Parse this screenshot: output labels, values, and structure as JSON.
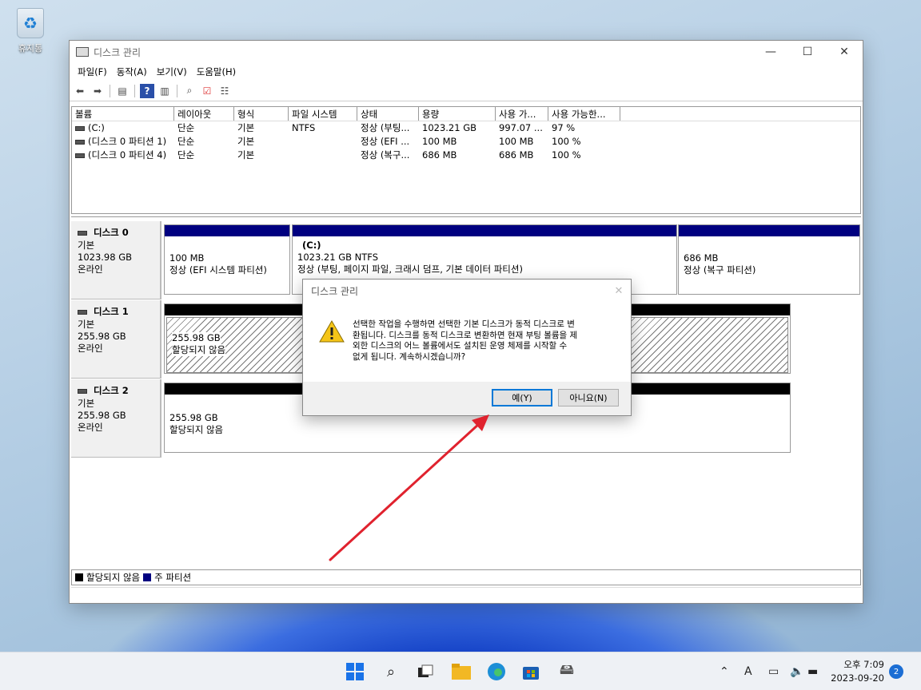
{
  "desktop": {
    "recycle_bin_label": "휴지통"
  },
  "window": {
    "title": "디스크 관리",
    "controls": {
      "minimize": "—",
      "maximize": "☐",
      "close": "✕"
    },
    "menu": [
      "파일(F)",
      "동작(A)",
      "보기(V)",
      "도움말(H)"
    ]
  },
  "volume_list": {
    "columns": [
      "볼륨",
      "레이아웃",
      "형식",
      "파일 시스템",
      "상태",
      "용량",
      "사용 가...",
      "사용 가능한..."
    ],
    "rows": [
      [
        "(C:)",
        "단순",
        "기본",
        "NTFS",
        "정상 (부팅...",
        "1023.21 GB",
        "997.07 ...",
        "97 %"
      ],
      [
        "(디스크 0 파티션 1)",
        "단순",
        "기본",
        "",
        "정상 (EFI ...",
        "100 MB",
        "100 MB",
        "100 %"
      ],
      [
        "(디스크 0 파티션 4)",
        "단순",
        "기본",
        "",
        "정상 (복구...",
        "686 MB",
        "686 MB",
        "100 %"
      ]
    ]
  },
  "disks": [
    {
      "name": "디스크 0",
      "type": "기본",
      "size": "1023.98 GB",
      "status": "온라인",
      "partitions": [
        {
          "label": "",
          "size": "100 MB",
          "status": "정상 (EFI 시스템 파티션)"
        },
        {
          "label": "(C:)",
          "size": "1023.21 GB NTFS",
          "status": "정상 (부팅, 페이지 파일, 크래시 덤프, 기본 데이터 파티션)"
        },
        {
          "label": "",
          "size": "686 MB",
          "status": "정상 (복구 파티션)"
        }
      ]
    },
    {
      "name": "디스크 1",
      "type": "기본",
      "size": "255.98 GB",
      "status": "온라인",
      "partitions": [
        {
          "size": "255.98 GB",
          "status": "할당되지 않음"
        }
      ]
    },
    {
      "name": "디스크 2",
      "type": "기본",
      "size": "255.98 GB",
      "status": "온라인",
      "partitions": [
        {
          "size": "255.98 GB",
          "status": "할당되지 않음"
        }
      ]
    }
  ],
  "legend": {
    "unallocated": "할당되지 않음",
    "primary": "주 파티션"
  },
  "dialog": {
    "title": "디스크 관리",
    "message_lines": [
      "선택한 작업을 수행하면 선택한 기본 디스크가 동적 디스크로 변",
      "환됩니다. 디스크를 동적 디스크로 변환하면 현재 부팅 볼륨을 제",
      "외한 디스크의 어느 볼륨에서도 설치된 운영 체제를 시작할 수",
      "없게 됩니다. 계속하시겠습니까?"
    ],
    "yes_label": "예(Y)",
    "no_label": "아니요(N)"
  },
  "colors": {
    "primary_partition": "#000080",
    "unallocated": "#000000",
    "arrow": "#e0222e",
    "accent": "#0078d7"
  },
  "taskbar": {
    "icons": [
      "windows-start-icon",
      "search-icon",
      "task-view-icon",
      "file-explorer-icon",
      "edge-icon",
      "store-icon",
      "disk-management-icon"
    ],
    "time": "오후 7:09",
    "date": "2023-09-20",
    "notification_count": "2",
    "ime": "A"
  }
}
